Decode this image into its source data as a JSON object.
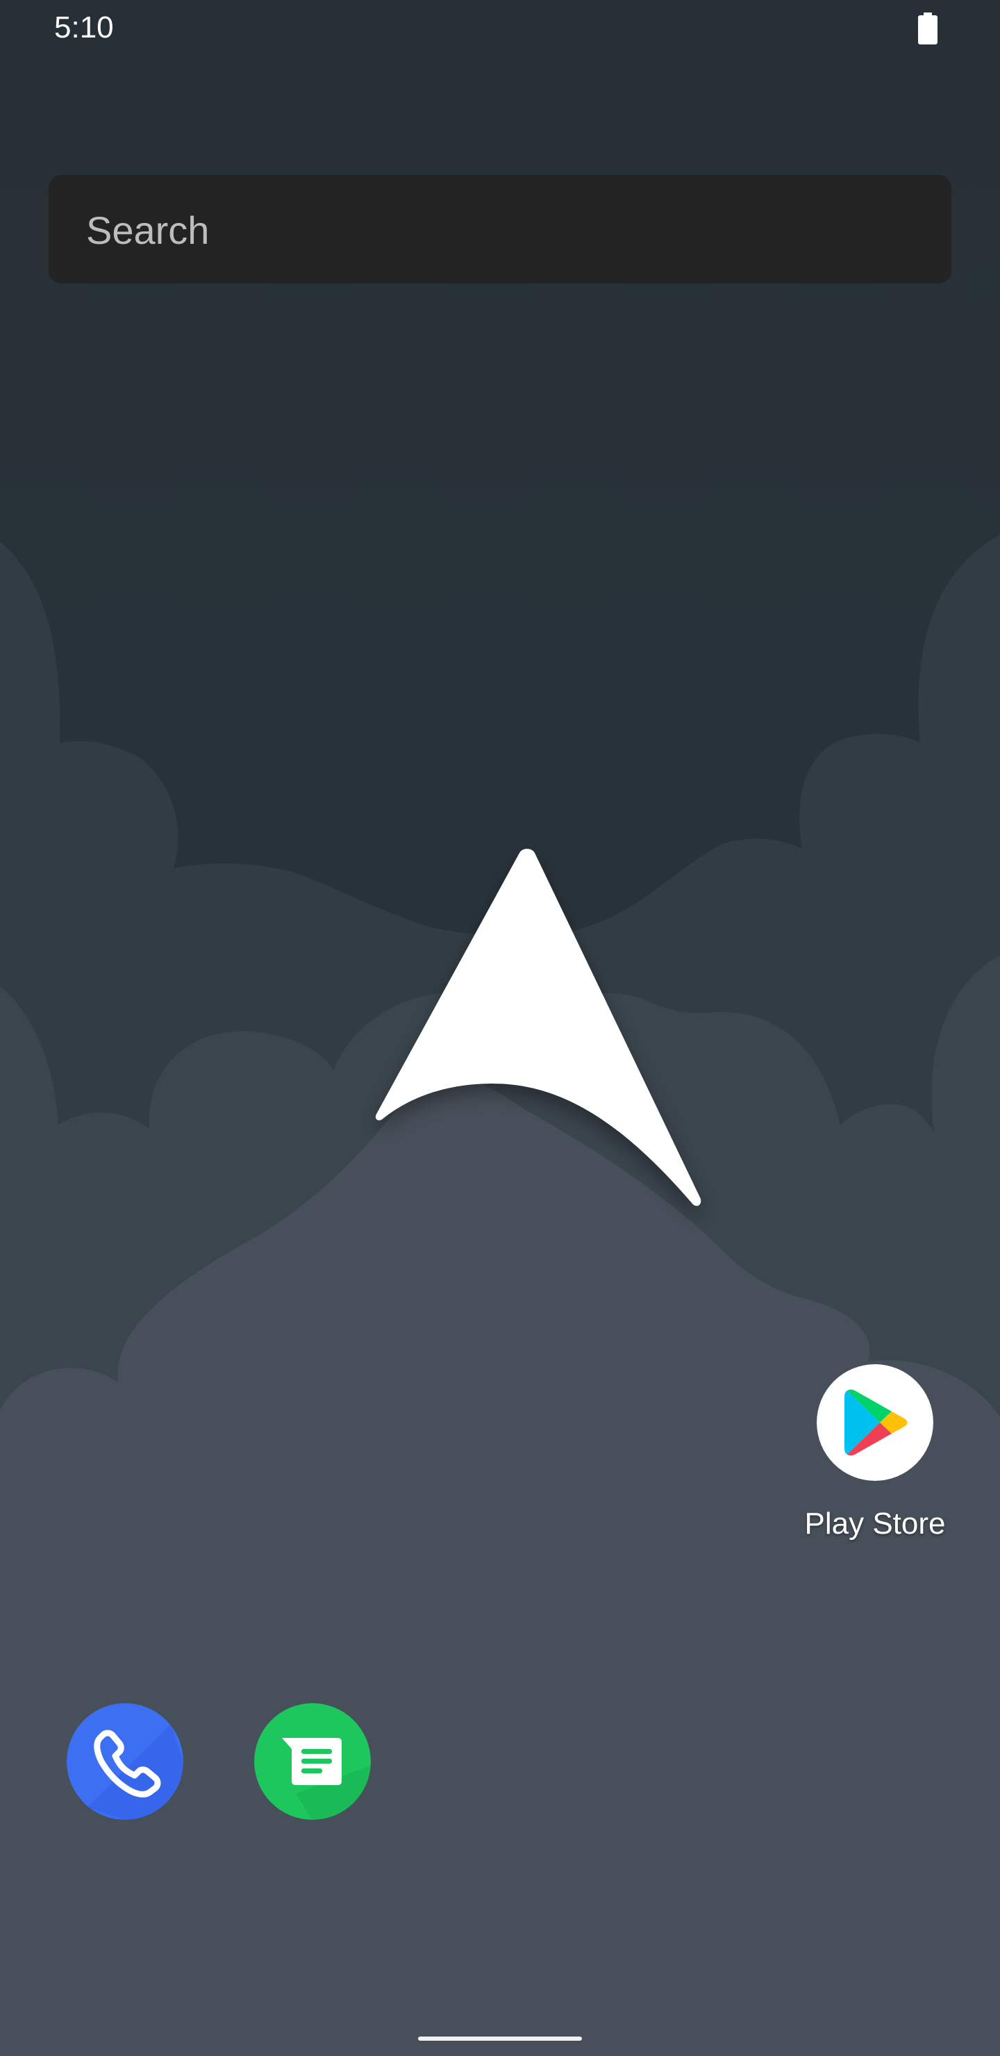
{
  "status_bar": {
    "time": "5:10",
    "battery_icon": "battery-icon"
  },
  "search": {
    "placeholder": "Search",
    "icon": "search-bar"
  },
  "home_apps": [
    {
      "label": "Play Store",
      "icon": "play-store-icon"
    }
  ],
  "dock": [
    {
      "icon": "phone-icon",
      "color": "#3d6ff2"
    },
    {
      "icon": "messages-icon",
      "color": "#1ec75e"
    }
  ],
  "wallpaper": {
    "logo_icon": "arrow-logo-icon",
    "sky_color": "#273137",
    "cloud_color": "#47505a"
  }
}
